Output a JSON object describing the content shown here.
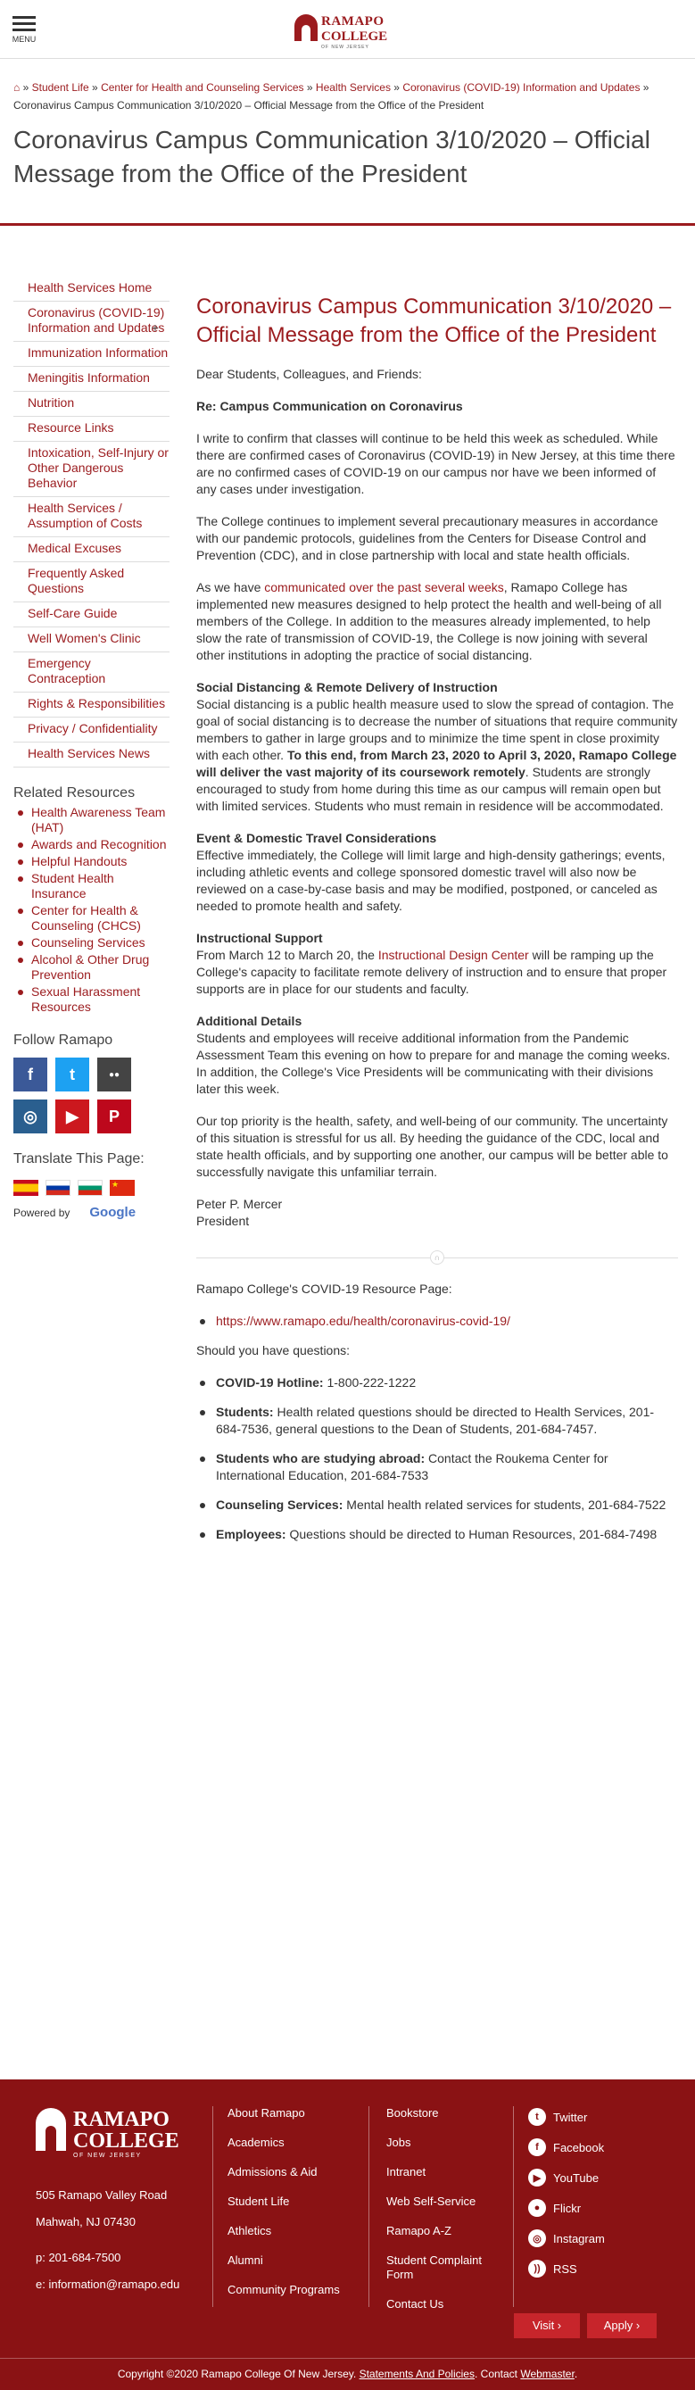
{
  "header": {
    "menu_label": "MENU",
    "logo_line1": "RAMAPO",
    "logo_line2": "COLLEGE",
    "logo_line3": "OF NEW JERSEY"
  },
  "breadcrumb": {
    "items": [
      "Student Life",
      "Center for Health and Counseling Services",
      "Health Services",
      "Coronavirus (COVID-19) Information and Updates"
    ],
    "separator": "»",
    "current": "Coronavirus Campus Communication 3/10/2020 – Official Message from the Office of the President"
  },
  "page_title": "Coronavirus Campus Communication 3/10/2020 – Official Message from the Office of the President",
  "sidebar": {
    "nav": [
      {
        "label": "Health Services Home"
      },
      {
        "label": "Coronavirus (COVID-19) Information and Updates",
        "expand": "+"
      },
      {
        "label": "Immunization Information"
      },
      {
        "label": "Meningitis Information"
      },
      {
        "label": "Nutrition"
      },
      {
        "label": "Resource Links"
      },
      {
        "label": "Intoxication, Self-Injury or Other Dangerous Behavior"
      },
      {
        "label": "Health Services / Assumption of Costs"
      },
      {
        "label": "Medical Excuses"
      },
      {
        "label": "Frequently Asked Questions"
      },
      {
        "label": "Self-Care Guide"
      },
      {
        "label": "Well Women's Clinic"
      },
      {
        "label": "Emergency Contraception"
      },
      {
        "label": "Rights & Responsibilities"
      },
      {
        "label": "Privacy / Confidentiality"
      },
      {
        "label": "Health Services News"
      }
    ],
    "related_heading": "Related Resources",
    "related": [
      "Health Awareness Team (HAT)",
      "Awards and Recognition",
      "Helpful Handouts",
      "Student Health Insurance",
      "Center for Health & Counseling (CHCS)",
      "Counseling Services",
      "Alcohol & Other Drug Prevention",
      "Sexual Harassment Resources"
    ],
    "follow_heading": "Follow Ramapo",
    "social": [
      {
        "icon": "facebook-icon",
        "glyph": "f",
        "color": "#3b5998"
      },
      {
        "icon": "twitter-icon",
        "glyph": "t",
        "color": "#1da1f2"
      },
      {
        "icon": "flickr-icon",
        "glyph": "●●",
        "color": "#444444"
      },
      {
        "icon": "instagram-icon",
        "glyph": "◎",
        "color": "#2a5f8f"
      },
      {
        "icon": "youtube-icon",
        "glyph": "▶",
        "color": "#cc181e"
      },
      {
        "icon": "pinterest-icon",
        "glyph": "P",
        "color": "#bd081c"
      }
    ],
    "translate_heading": "Translate This Page:",
    "powered_by": "Powered by",
    "google": "Google"
  },
  "main": {
    "heading": "Coronavirus Campus Communication 3/10/2020 – Official Message from the Office of the President",
    "greeting": "Dear Students, Colleagues, and Friends:",
    "re_line": "Re: Campus Communication on Coronavirus",
    "p1": "I write to confirm that classes will continue to be held this week as scheduled. While there are confirmed cases of Coronavirus (COVID-19) in New Jersey, at this time there are no confirmed cases of COVID-19 on our campus nor have we been informed of any cases under investigation.",
    "p2": "The College continues to implement several precautionary measures in accordance with our pandemic protocols, guidelines from the Centers for Disease Control and Prevention (CDC), and in close partnership with local and state health officials.",
    "p3_before": "As we have ",
    "p3_link": "communicated over the past several weeks",
    "p3_after": ", Ramapo College has implemented new measures designed to help protect the health and well-being of all members of the College.  In addition to the measures already implemented, to help slow the rate of transmission of COVID-19, the College is now joining with several other institutions in adopting the practice of social distancing.",
    "s1_title": "Social Distancing & Remote Delivery of Instruction",
    "s1_text_a": "Social distancing is a public health measure used to slow the spread of contagion. The goal of social distancing is to decrease the number of situations that require community members to gather in large groups and to minimize the time spent in close proximity with each other.  ",
    "s1_bold": "To this end, from March 23, 2020 to April 3, 2020, Ramapo College will deliver the vast majority of its coursework remotely",
    "s1_text_b": ". Students are strongly encouraged to study from home during this time as our campus will remain open but with limited services. Students who must remain in residence will be accommodated.",
    "s2_title": "Event & Domestic Travel Considerations",
    "s2_text": "Effective immediately, the College will limit large and high-density gatherings; events, including athletic events and college sponsored domestic travel will also now be reviewed on a case-by-case basis and may be modified, postponed, or canceled as needed to promote health and safety.",
    "s3_title": "Instructional Support",
    "s3_before": "From March 12 to March 20, the ",
    "s3_link": "Instructional Design Center",
    "s3_after": " will be ramping up the College's capacity to facilitate remote delivery of instruction and to ensure that proper supports are in place for our students and faculty.",
    "s4_title": "Additional Details",
    "s4_text": "Students and employees will receive additional information from the Pandemic Assessment Team this evening on how to prepare for and manage the coming weeks. In addition, the College's Vice Presidents will be communicating with their divisions later this week.",
    "p_priority": "Our top priority is the health, safety, and well-being of our community. The uncertainty of this situation is stressful for us all. By heeding the guidance of the CDC, local and state health officials, and by supporting one another, our campus will be better able to successfully navigate this unfamiliar terrain.",
    "sig_name": "Peter P. Mercer",
    "sig_title": "President",
    "resource_intro": "Ramapo College's COVID-19 Resource Page:",
    "resource_link": "https://www.ramapo.edu/health/coronavirus-covid-19/",
    "questions_intro": "Should you have questions:",
    "questions": [
      {
        "label": "COVID-19 Hotline:",
        "text": " 1-800-222-1222"
      },
      {
        "label": "Students:",
        "text": " Health related questions should be directed to Health Services, 201-684-7536, general questions to the Dean of Students, 201-684-7457."
      },
      {
        "label": "Students who are studying abroad:",
        "text": " Contact the Roukema Center for International Education, 201-684-7533"
      },
      {
        "label": "Counseling Services:",
        "text": " Mental health related services for students, 201-684-7522"
      },
      {
        "label": "Employees:",
        "text": " Questions should be directed to Human Resources, 201-684-7498"
      }
    ]
  },
  "footer": {
    "logo_line1": "RAMAPO",
    "logo_line2": "COLLEGE",
    "logo_line3": "OF NEW JERSEY",
    "address1": "505 Ramapo Valley Road",
    "address2": "Mahwah, NJ 07430",
    "phone": "p: 201-684-7500",
    "email": "e: information@ramapo.edu",
    "col1": [
      "About Ramapo",
      "Academics",
      "Admissions & Aid",
      "Student Life",
      "Athletics",
      "Alumni",
      "Community Programs"
    ],
    "col2": [
      "Bookstore",
      "Jobs",
      "Intranet",
      "Web Self-Service",
      "Ramapo A-Z",
      "Student Complaint Form",
      "Contact Us"
    ],
    "social": [
      {
        "label": "Twitter",
        "icon": "twitter-icon",
        "glyph": "t"
      },
      {
        "label": "Facebook",
        "icon": "facebook-icon",
        "glyph": "f"
      },
      {
        "label": "YouTube",
        "icon": "youtube-icon",
        "glyph": "▶"
      },
      {
        "label": "Flickr",
        "icon": "flickr-icon",
        "glyph": "●"
      },
      {
        "label": "Instagram",
        "icon": "instagram-icon",
        "glyph": "◎"
      },
      {
        "label": "RSS",
        "icon": "rss-icon",
        "glyph": "))"
      }
    ],
    "visit_label": "Visit ›",
    "apply_label": "Apply ›",
    "copyright_before": "Copyright ©2020 Ramapo College Of New Jersey. ",
    "policies_link": "Statements And Policies",
    "copyright_mid": ". Contact ",
    "webmaster_link": "Webmaster",
    "copyright_end": "."
  },
  "colors": {
    "brand": "#9b1b1e",
    "footer_bg": "#8a1214",
    "button": "#c7252b"
  }
}
